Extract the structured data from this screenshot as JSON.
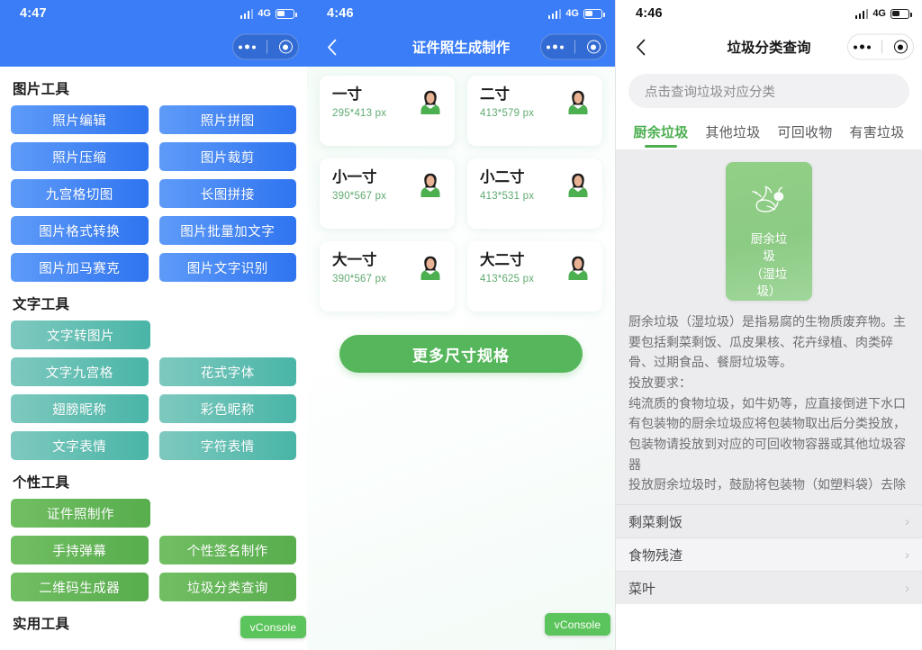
{
  "panel1": {
    "status": {
      "time": "4:47",
      "network": "4G"
    },
    "capsule": {
      "menu_icon": "more-dots-icon",
      "target_icon": "target-circle-icon"
    },
    "sections": [
      {
        "title": "图片工具",
        "style": "blue",
        "rows": [
          [
            "照片编辑",
            "照片拼图"
          ],
          [
            "照片压缩",
            "图片裁剪"
          ],
          [
            "九宫格切图",
            "长图拼接"
          ],
          [
            "图片格式转换",
            "图片批量加文字"
          ],
          [
            "图片加马赛克",
            "图片文字识别"
          ]
        ]
      },
      {
        "title": "文字工具",
        "style": "teal",
        "rows": [
          [
            "文字转图片"
          ],
          [
            "文字九宫格",
            "花式字体"
          ],
          [
            "翅膀昵称",
            "彩色昵称"
          ],
          [
            "文字表情",
            "字符表情"
          ]
        ]
      },
      {
        "title": "个性工具",
        "style": "green",
        "rows": [
          [
            "证件照制作"
          ],
          [
            "手持弹幕",
            "个性签名制作"
          ],
          [
            "二维码生成器",
            "垃圾分类查询"
          ]
        ]
      },
      {
        "title": "实用工具",
        "style": "green",
        "rows": []
      }
    ],
    "vconsole": "vConsole"
  },
  "panel2": {
    "status": {
      "time": "4:46",
      "network": "4G"
    },
    "nav": {
      "title": "证件照生成制作",
      "back_icon": "chevron-left-icon"
    },
    "sizes": [
      {
        "name": "一寸",
        "px": "295*413 px"
      },
      {
        "name": "二寸",
        "px": "413*579 px"
      },
      {
        "name": "小一寸",
        "px": "390*567 px"
      },
      {
        "name": "小二寸",
        "px": "413*531 px"
      },
      {
        "name": "大一寸",
        "px": "390*567 px"
      },
      {
        "name": "大二寸",
        "px": "413*625 px"
      }
    ],
    "more_button": "更多尺寸规格",
    "vconsole": "vConsole"
  },
  "panel3": {
    "status": {
      "time": "4:46",
      "network": "4G"
    },
    "nav": {
      "title": "垃圾分类查询",
      "back_icon": "chevron-left-icon"
    },
    "search": {
      "placeholder": "点击查询垃圾对应分类"
    },
    "tabs": [
      {
        "label": "厨余垃圾",
        "active": true
      },
      {
        "label": "其他垃圾",
        "active": false
      },
      {
        "label": "可回收物",
        "active": false
      },
      {
        "label": "有害垃圾",
        "active": false
      }
    ],
    "card": {
      "line1": "厨余垃圾",
      "line2": "（湿垃",
      "line3": "圾）",
      "icon": "food-waste-icon"
    },
    "description": {
      "lead": "厨余垃圾（湿垃圾）",
      "rest": "是指易腐的生物质废弃物。主要包括剩菜剩饭、瓜皮果核、花卉绿植、肉类碎骨、过期食品、餐厨垃圾等。",
      "line_req": "投放要求：",
      "line_a": "纯流质的食物垃圾，如牛奶等，应直接倒进下水口",
      "line_b": "有包装物的厨余垃圾应将包装物取出后分类投放，包装物请投放到对应的可回收物容器或其他垃圾容器",
      "line_c": "投放厨余垃圾时，鼓励将包装物（如塑料袋）去除"
    },
    "list": [
      {
        "label": "剩菜剩饭"
      },
      {
        "label": "食物残渣"
      },
      {
        "label": "菜叶"
      }
    ],
    "chevron": "›"
  },
  "colors": {
    "blue": "#3b7df6",
    "green": "#56b65c",
    "teal": "#49b5a7",
    "card_green": "#8ccb84",
    "tab_active": "#4caf50"
  }
}
